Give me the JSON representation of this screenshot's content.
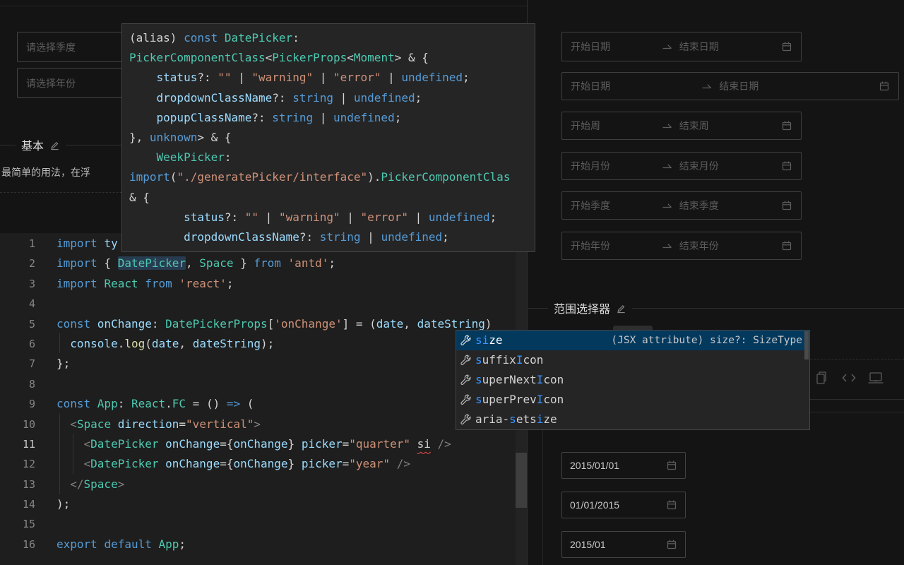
{
  "left_preview": {
    "quarter_placeholder": "请选择季度",
    "year_placeholder": "请选择年份",
    "section_title": "基本",
    "description": "最简单的用法，在浮"
  },
  "tooltip": {
    "lines": [
      [
        [
          "(alias) ",
          "plain"
        ],
        [
          "const ",
          "kw"
        ],
        [
          "DatePicker",
          "type"
        ],
        [
          ":",
          "plain"
        ]
      ],
      [
        [
          "PickerComponentClass",
          "type"
        ],
        [
          "<",
          "plain"
        ],
        [
          "PickerProps",
          "type"
        ],
        [
          "<",
          "plain"
        ],
        [
          "Moment",
          "type"
        ],
        [
          "> & {",
          "plain"
        ]
      ],
      [
        [
          "    status",
          "var"
        ],
        [
          "?: ",
          "plain"
        ],
        [
          "\"\"",
          "str"
        ],
        [
          " | ",
          "plain"
        ],
        [
          "\"warning\"",
          "str"
        ],
        [
          " | ",
          "plain"
        ],
        [
          "\"error\"",
          "str"
        ],
        [
          " | ",
          "plain"
        ],
        [
          "undefined",
          "kw"
        ],
        [
          ";",
          "plain"
        ]
      ],
      [
        [
          "    dropdownClassName",
          "var"
        ],
        [
          "?: ",
          "plain"
        ],
        [
          "string",
          "kw"
        ],
        [
          " | ",
          "plain"
        ],
        [
          "undefined",
          "kw"
        ],
        [
          ";",
          "plain"
        ]
      ],
      [
        [
          "    popupClassName",
          "var"
        ],
        [
          "?: ",
          "plain"
        ],
        [
          "string",
          "kw"
        ],
        [
          " | ",
          "plain"
        ],
        [
          "undefined",
          "kw"
        ],
        [
          ";",
          "plain"
        ]
      ],
      [
        [
          "}, ",
          "plain"
        ],
        [
          "unknown",
          "kw"
        ],
        [
          "> & {",
          "plain"
        ]
      ],
      [
        [
          "    WeekPicker",
          "type"
        ],
        [
          ":",
          "plain"
        ]
      ],
      [
        [
          "import",
          "kw"
        ],
        [
          "(",
          "plain"
        ],
        [
          "\"./generatePicker/interface\"",
          "str"
        ],
        [
          ").",
          "plain"
        ],
        [
          "PickerComponentClas",
          "type"
        ]
      ],
      [
        [
          "& {",
          "plain"
        ]
      ],
      [
        [
          "        status",
          "var"
        ],
        [
          "?: ",
          "plain"
        ],
        [
          "\"\"",
          "str"
        ],
        [
          " | ",
          "plain"
        ],
        [
          "\"warning\"",
          "str"
        ],
        [
          " | ",
          "plain"
        ],
        [
          "\"error\"",
          "str"
        ],
        [
          " | ",
          "plain"
        ],
        [
          "undefined",
          "kw"
        ],
        [
          ";",
          "plain"
        ]
      ],
      [
        [
          "        dropdownClassName",
          "var"
        ],
        [
          "?: ",
          "plain"
        ],
        [
          "string",
          "kw"
        ],
        [
          " | ",
          "plain"
        ],
        [
          "undefined",
          "kw"
        ],
        [
          ";",
          "plain"
        ]
      ]
    ]
  },
  "editor": {
    "lines": [
      {
        "num": "1",
        "tokens": [
          [
            "import ",
            "kw"
          ],
          [
            "ty",
            "var"
          ]
        ]
      },
      {
        "num": "2",
        "tokens": [
          [
            "import ",
            "kw"
          ],
          [
            "{ ",
            "plain"
          ],
          [
            "DatePicker",
            "type hl"
          ],
          [
            ", ",
            "plain"
          ],
          [
            "Space",
            "type"
          ],
          [
            " } ",
            "plain"
          ],
          [
            "from ",
            "kw"
          ],
          [
            "'antd'",
            "str"
          ],
          [
            ";",
            "plain"
          ]
        ]
      },
      {
        "num": "3",
        "tokens": [
          [
            "import ",
            "kw"
          ],
          [
            "React ",
            "type"
          ],
          [
            "from ",
            "kw"
          ],
          [
            "'react'",
            "str"
          ],
          [
            ";",
            "plain"
          ]
        ]
      },
      {
        "num": "4",
        "tokens": []
      },
      {
        "num": "5",
        "tokens": [
          [
            "const ",
            "kw"
          ],
          [
            "onChange",
            "var"
          ],
          [
            ": ",
            "plain"
          ],
          [
            "DatePickerProps",
            "type"
          ],
          [
            "[",
            "plain"
          ],
          [
            "'onChange'",
            "str"
          ],
          [
            "]",
            "plain"
          ],
          [
            " = (",
            "plain"
          ],
          [
            "date",
            "var"
          ],
          [
            ", ",
            "plain"
          ],
          [
            "dateString",
            "var"
          ],
          [
            ")",
            "plain"
          ]
        ]
      },
      {
        "num": "6",
        "tokens": [
          [
            "  ",
            "plain"
          ],
          [
            "console",
            "var"
          ],
          [
            ".",
            "plain"
          ],
          [
            "log",
            "fn"
          ],
          [
            "(",
            "plain"
          ],
          [
            "date",
            "var"
          ],
          [
            ", ",
            "plain"
          ],
          [
            "dateString",
            "var"
          ],
          [
            ");",
            "plain"
          ]
        ]
      },
      {
        "num": "7",
        "tokens": [
          [
            "};",
            "plain"
          ]
        ]
      },
      {
        "num": "8",
        "tokens": []
      },
      {
        "num": "9",
        "tokens": [
          [
            "const ",
            "kw"
          ],
          [
            "App",
            "type"
          ],
          [
            ": ",
            "plain"
          ],
          [
            "React",
            "type"
          ],
          [
            ".",
            "plain"
          ],
          [
            "FC",
            "type"
          ],
          [
            " = () ",
            "plain"
          ],
          [
            "=>",
            "kw"
          ],
          [
            " (",
            "plain"
          ]
        ]
      },
      {
        "num": "10",
        "tokens": [
          [
            "  ",
            "plain"
          ],
          [
            "<",
            "tag"
          ],
          [
            "Space",
            "type"
          ],
          [
            " direction",
            "var"
          ],
          [
            "=",
            "plain"
          ],
          [
            "\"vertical\"",
            "str"
          ],
          [
            ">",
            "tag"
          ]
        ]
      },
      {
        "num": "11",
        "active": true,
        "tokens": [
          [
            "    ",
            "plain"
          ],
          [
            "<",
            "tag"
          ],
          [
            "DatePicker",
            "type"
          ],
          [
            " onChange",
            "var"
          ],
          [
            "=",
            "plain"
          ],
          [
            "{",
            "plain"
          ],
          [
            "onChange",
            "var"
          ],
          [
            "}",
            "plain"
          ],
          [
            " picker",
            "var"
          ],
          [
            "=",
            "plain"
          ],
          [
            "\"quarter\"",
            "str"
          ],
          [
            " ",
            "plain"
          ],
          [
            "si",
            "plain sq"
          ],
          [
            " ",
            "plain"
          ],
          [
            "/>",
            "tag"
          ]
        ]
      },
      {
        "num": "12",
        "tokens": [
          [
            "    ",
            "plain"
          ],
          [
            "<",
            "tag"
          ],
          [
            "DatePicker",
            "type"
          ],
          [
            " onChange",
            "var"
          ],
          [
            "=",
            "plain"
          ],
          [
            "{",
            "plain"
          ],
          [
            "onChange",
            "var"
          ],
          [
            "}",
            "plain"
          ],
          [
            " picker",
            "var"
          ],
          [
            "=",
            "plain"
          ],
          [
            "\"year\"",
            "str"
          ],
          [
            " ",
            "plain"
          ],
          [
            "/>",
            "tag"
          ]
        ]
      },
      {
        "num": "13",
        "tokens": [
          [
            "  ",
            "plain"
          ],
          [
            "</",
            "tag"
          ],
          [
            "Space",
            "type"
          ],
          [
            ">",
            "tag"
          ]
        ]
      },
      {
        "num": "14",
        "tokens": [
          [
            ");",
            "plain"
          ]
        ]
      },
      {
        "num": "15",
        "tokens": []
      },
      {
        "num": "16",
        "tokens": [
          [
            "export ",
            "kw"
          ],
          [
            "default ",
            "kw"
          ],
          [
            "App",
            "type"
          ],
          [
            ";",
            "plain"
          ]
        ]
      }
    ]
  },
  "suggest": {
    "items": [
      {
        "parts": [
          [
            "si",
            true
          ],
          [
            "ze",
            false
          ]
        ],
        "detail": "(JSX attribute) size?: SizeType",
        "selected": true
      },
      {
        "parts": [
          [
            "s",
            true
          ],
          [
            "uffix",
            false
          ],
          [
            "I",
            true
          ],
          [
            "con",
            false
          ]
        ]
      },
      {
        "parts": [
          [
            "s",
            true
          ],
          [
            "uperNext",
            false
          ],
          [
            "I",
            true
          ],
          [
            "con",
            false
          ]
        ]
      },
      {
        "parts": [
          [
            "s",
            true
          ],
          [
            "uperPrev",
            false
          ],
          [
            "I",
            true
          ],
          [
            "con",
            false
          ]
        ]
      },
      {
        "parts": [
          [
            "aria-",
            false
          ],
          [
            "s",
            true
          ],
          [
            "ets",
            false
          ],
          [
            "i",
            true
          ],
          [
            "ze",
            false
          ]
        ]
      }
    ]
  },
  "right_preview": {
    "range_pickers": [
      {
        "start": "开始日期",
        "end": "结束日期"
      },
      {
        "start": "开始日期",
        "end": "结束日期"
      },
      {
        "start": "开始周",
        "end": "结束周"
      },
      {
        "start": "开始月份",
        "end": "结束月份"
      },
      {
        "start": "开始季度",
        "end": "结束季度"
      },
      {
        "start": "开始年份",
        "end": "结束年份"
      }
    ],
    "section_title": "范围选择器",
    "date_values": [
      "2015/01/01",
      "01/01/2015",
      "2015/01"
    ]
  },
  "icons": {
    "suggest_item": "wrench",
    "picker_suffix": "calendar",
    "range_separator": "swap-right-arrow",
    "section_edit": "pencil",
    "actions": [
      "copy",
      "code",
      "sandbox-laptop"
    ]
  },
  "colors": {
    "editor_bg": "#1e1e1e",
    "page_bg": "#141414",
    "suggest_selected_bg": "#04395e",
    "match_blue": "#3794ff",
    "error_red": "#f14c4c",
    "keyword_blue": "#569cd6",
    "type_teal": "#4ec9b0",
    "string_orange": "#ce9178",
    "variable_blue": "#9cdcfe"
  }
}
